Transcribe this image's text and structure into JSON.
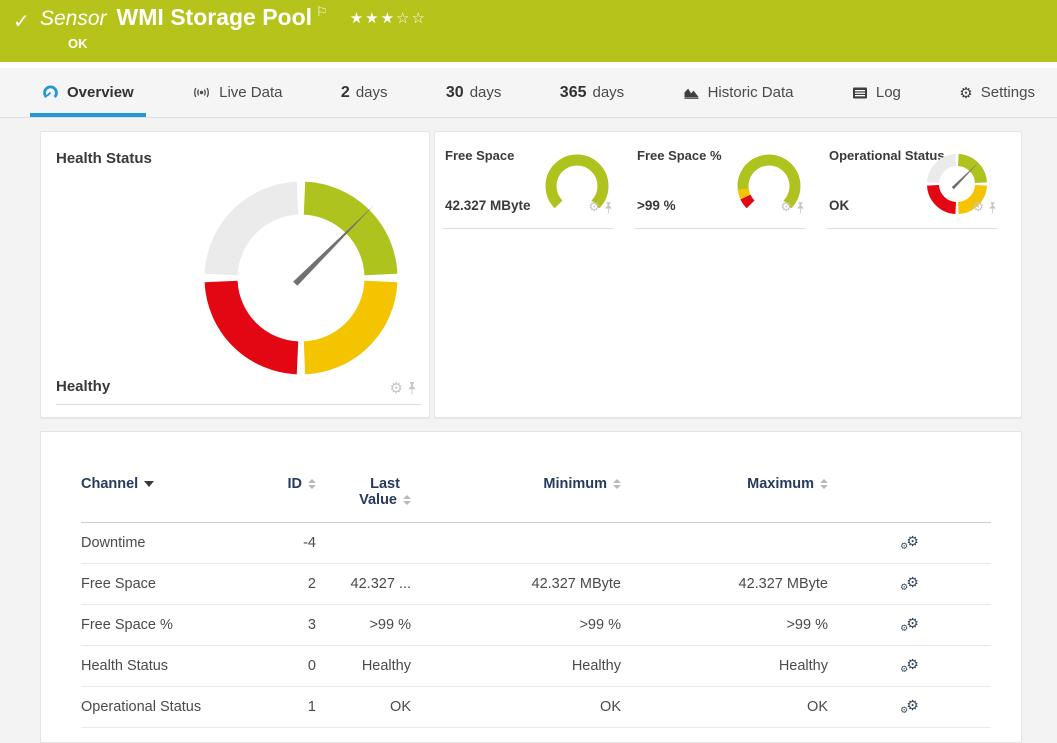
{
  "header": {
    "check_icon": "✓",
    "kind_label": "Sensor",
    "title": "WMI Storage Pool",
    "flag_icon": "⚐",
    "rating": "★★★☆☆",
    "status": "OK"
  },
  "tabs": [
    {
      "label": "Overview",
      "icon": "gauge-icon",
      "active": true
    },
    {
      "label": "Live Data",
      "icon": "broadcast-icon"
    },
    {
      "num": "2",
      "label": "days"
    },
    {
      "num": "30",
      "label": "days"
    },
    {
      "num": "365",
      "label": "days"
    },
    {
      "label": "Historic Data",
      "icon": "area-chart-icon"
    },
    {
      "label": "Log",
      "icon": "log-icon"
    },
    {
      "label": "Settings",
      "icon": "gear-icon"
    }
  ],
  "gauges": {
    "health": {
      "title": "Health Status",
      "value": "Healthy",
      "type": "quadrant-donut"
    },
    "minis": [
      {
        "title": "Free Space",
        "value": "42.327 MByte",
        "type": "arc-270"
      },
      {
        "title": "Free Space %",
        "value": ">99 %",
        "type": "arc-270-segmented"
      },
      {
        "title": "Operational Status",
        "value": "OK",
        "type": "quadrant-donut"
      }
    ]
  },
  "icons": {
    "gear": "⚙",
    "pin": "pushpin",
    "sort": "sort-arrows"
  },
  "colors": {
    "header_green": "#b5c31a",
    "gauge_green": "#aec31d",
    "gauge_yellow": "#f5c400",
    "gauge_red": "#e30613",
    "gauge_gray": "#ebebeb",
    "needle_gray": "#717171",
    "active_tab_blue": "#2398d4"
  },
  "table": {
    "headers": {
      "channel": "Channel",
      "id": "ID",
      "last_line1": "Last",
      "last_line2": "Value",
      "minimum": "Minimum",
      "maximum": "Maximum"
    },
    "rows": [
      {
        "channel": "Downtime",
        "id": "-4",
        "last": "",
        "min": "",
        "max": ""
      },
      {
        "channel": "Free Space",
        "id": "2",
        "last": "42.327 ...",
        "min": "42.327 MByte",
        "max": "42.327 MByte"
      },
      {
        "channel": "Free Space %",
        "id": "3",
        "last": ">99 %",
        "min": ">99 %",
        "max": ">99 %"
      },
      {
        "channel": "Health Status",
        "id": "0",
        "last": "Healthy",
        "min": "Healthy",
        "max": "Healthy"
      },
      {
        "channel": "Operational Status",
        "id": "1",
        "last": "OK",
        "min": "OK",
        "max": "OK"
      }
    ]
  }
}
